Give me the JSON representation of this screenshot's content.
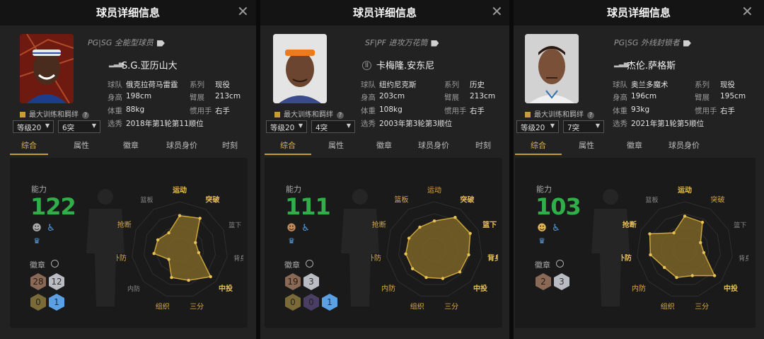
{
  "panels": [
    {
      "title": "球员详细信息",
      "position_tag": "PG|SG 全能型球员",
      "name": "S.G.亚历山大",
      "labels": {
        "team": "球队",
        "height": "身高",
        "weight": "体重",
        "draft": "选秀",
        "series": "系列",
        "wingspan": "臂展",
        "hand": "惯用手"
      },
      "team": "俄克拉荷马雷霆",
      "height": "198cm",
      "weight": "88kg",
      "draft": "2018年第1轮第11顺位",
      "series": "现役",
      "wingspan": "213cm",
      "hand": "右手",
      "train_label": "最大训练和羁绊",
      "level_select": "等级20",
      "breakthrough_select": "6突",
      "tabs": [
        "综合",
        "属性",
        "徽章",
        "球员身价",
        "时刻"
      ],
      "ability_label": "能力",
      "ability_value": "122",
      "badge_label": "徽章",
      "badges": [
        "28",
        "12",
        "0",
        "1"
      ],
      "radar": {
        "labels": [
          "运动",
          "突破",
          "篮下",
          "背身",
          "中投",
          "三分",
          "组织",
          "内防",
          "外防",
          "抢断",
          "篮板"
        ],
        "values": [
          0.71,
          0.78,
          0.36,
          0.4,
          0.85,
          0.66,
          0.6,
          0.3,
          0.54,
          0.5,
          0.42
        ]
      }
    },
    {
      "title": "球员详细信息",
      "position_tag": "SF|PF 进攻万花筒",
      "name": "卡梅隆.安东尼",
      "labels": {
        "team": "球队",
        "height": "身高",
        "weight": "体重",
        "draft": "选秀",
        "series": "系列",
        "wingspan": "臂展",
        "hand": "惯用手"
      },
      "team": "纽约尼克斯",
      "height": "203cm",
      "weight": "108kg",
      "draft": "2003年第3轮第3顺位",
      "series": "历史",
      "wingspan": "213cm",
      "hand": "右手",
      "train_label": "最大训练和羁绊",
      "level_select": "等级20",
      "breakthrough_select": "4突",
      "tabs": [
        "综合",
        "属性",
        "徽章",
        "球员身价",
        "时刻"
      ],
      "ability_label": "能力",
      "ability_value": "111",
      "badge_label": "徽章",
      "badges": [
        "19",
        "3",
        "0",
        "0",
        "1"
      ],
      "radar": {
        "labels": [
          "运动",
          "突破",
          "篮下",
          "背身",
          "中投",
          "三分",
          "组织",
          "内防",
          "外防",
          "抢断",
          "篮板"
        ],
        "values": [
          0.6,
          0.8,
          0.82,
          0.72,
          0.7,
          0.62,
          0.6,
          0.6,
          0.6,
          0.58,
          0.56
        ]
      }
    },
    {
      "title": "球员详细信息",
      "position_tag": "PG|SG 外线封锁者",
      "name": "杰伦.萨格斯",
      "labels": {
        "team": "球队",
        "height": "身高",
        "weight": "体重",
        "draft": "选秀",
        "series": "系列",
        "wingspan": "臂展",
        "hand": "惯用手"
      },
      "team": "奥兰多魔术",
      "height": "196cm",
      "weight": "93kg",
      "draft": "2021年第1轮第5顺位",
      "series": "现役",
      "wingspan": "195cm",
      "hand": "右手",
      "train_label": "最大训练和羁绊",
      "level_select": "等级20",
      "breakthrough_select": "7突",
      "tabs": [
        "综合",
        "属性",
        "徽章",
        "球员身价"
      ],
      "ability_label": "能力",
      "ability_value": "103",
      "badge_label": "徽章",
      "badges": [
        "2",
        "3"
      ],
      "radar": {
        "labels": [
          "运动",
          "突破",
          "篮下",
          "背身",
          "中投",
          "三分",
          "组织",
          "内防",
          "外防",
          "抢断",
          "篮板"
        ],
        "values": [
          0.7,
          0.68,
          0.36,
          0.4,
          0.82,
          0.56,
          0.6,
          0.56,
          0.72,
          0.8,
          0.42
        ]
      }
    }
  ],
  "colors": {
    "ability_green": "#2fae4a",
    "accent_gold": "#c89a3a",
    "radar_fill": "#7a6428",
    "panel_bg": "#222222"
  },
  "icons": [
    "close-icon",
    "tag-icon",
    "signal-icon",
    "help-icon",
    "chevron-down-icon",
    "search-icon",
    "team-trait-icon",
    "role-trait-icon",
    "crown-icon"
  ]
}
